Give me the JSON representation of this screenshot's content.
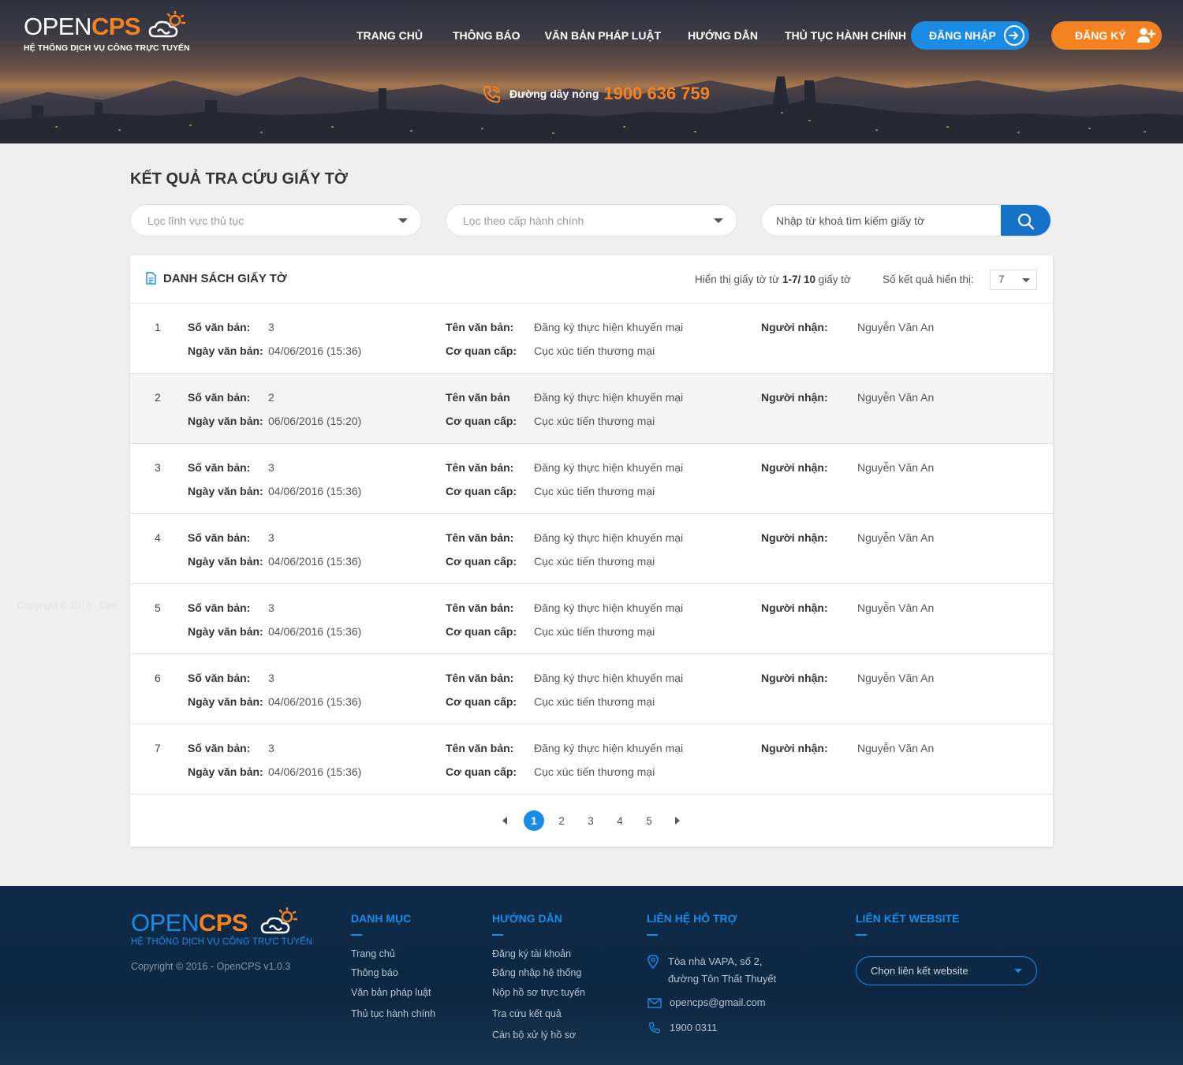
{
  "brand": {
    "name_part1": "OPEN",
    "name_part2": "CPS",
    "subtitle": "HỆ THỐNG DỊCH VỤ CÔNG TRỰC TUYẾN"
  },
  "nav": {
    "items": [
      {
        "label": "TRANG CHỦ"
      },
      {
        "label": "THÔNG BÁO"
      },
      {
        "label": "VĂN BẢN PHÁP LUẬT"
      },
      {
        "label": "HƯỚNG DẪN"
      },
      {
        "label": "THỦ TỤC HÀNH CHÍNH"
      }
    ],
    "login_label": "ĐĂNG NHẬP",
    "register_label": "ĐĂNG KÝ"
  },
  "hotline": {
    "label": "Đường dây nóng",
    "number": "1900 636 759"
  },
  "main": {
    "title": "KẾT QUẢ TRA CỨU GIẤY TỜ",
    "filter_field_placeholder": "Lọc lĩnh vực thủ tục",
    "filter_level_placeholder": "Lọc theo cấp hành chính",
    "search_placeholder": "Nhập từ khoá tìm kiếm giấy tờ"
  },
  "list": {
    "title": "DANH SÁCH GIẤY TỜ",
    "showing_prefix": "Hiển thị giấy tờ từ",
    "showing_range": "1-7/ 10",
    "showing_suffix": "giấy tờ",
    "per_page_label": "Số kết quả hiển thị:",
    "per_page_value": "7",
    "rows": [
      {
        "index": "1",
        "so_label": "Số văn bản:",
        "so": "3",
        "ngay_label": "Ngày văn bản:",
        "ngay": "04/06/2016 (15:36)",
        "ten_label": "Tên văn bản:",
        "ten": "Đăng ký thực hiện khuyến mại",
        "coquan_label": "Cơ quan cấp:",
        "coquan": "Cục xúc tiến thương mại",
        "nguoinhan_label": "Người nhận:",
        "nguoinhan": "Nguyễn Văn An"
      },
      {
        "index": "2",
        "so_label": "Số văn bản:",
        "so": "2",
        "ngay_label": "Ngày văn bản:",
        "ngay": "06/06/2016 (15:20)",
        "ten_label": "Tên văn bản",
        "ten": "Đăng ký thực hiện khuyến mại",
        "coquan_label": "Cơ quan cấp:",
        "coquan": "Cục xúc tiến thương mại",
        "nguoinhan_label": "Người nhận:",
        "nguoinhan": "Nguyễn Văn An"
      },
      {
        "index": "3",
        "so_label": "Số văn bản:",
        "so": "3",
        "ngay_label": "Ngày văn bản:",
        "ngay": "04/06/2016 (15:36)",
        "ten_label": "Tên văn bản:",
        "ten": "Đăng ký thực hiện khuyến mại",
        "coquan_label": "Cơ quan cấp:",
        "coquan": "Cục xúc tiến thương mại",
        "nguoinhan_label": "Người nhận:",
        "nguoinhan": "Nguyễn Văn An"
      },
      {
        "index": "4",
        "so_label": "Số văn bản:",
        "so": "3",
        "ngay_label": "Ngày văn bản:",
        "ngay": "04/06/2016 (15:36)",
        "ten_label": "Tên văn bản:",
        "ten": "Đăng ký thực hiện khuyến mại",
        "coquan_label": "Cơ quan cấp:",
        "coquan": "Cục xúc tiến thương mại",
        "nguoinhan_label": "Người nhận:",
        "nguoinhan": "Nguyễn Văn An"
      },
      {
        "index": "5",
        "so_label": "Số văn bản:",
        "so": "3",
        "ngay_label": "Ngày văn bản:",
        "ngay": "04/06/2016 (15:36)",
        "ten_label": "Tên văn bản:",
        "ten": "Đăng ký thực hiện khuyến mại",
        "coquan_label": "Cơ quan cấp:",
        "coquan": "Cục xúc tiến thương mại",
        "nguoinhan_label": "Người nhận:",
        "nguoinhan": "Nguyễn Văn An"
      },
      {
        "index": "6",
        "so_label": "Số văn bản:",
        "so": "3",
        "ngay_label": "Ngày văn bản:",
        "ngay": "04/06/2016 (15:36)",
        "ten_label": "Tên văn bản:",
        "ten": "Đăng ký thực hiện khuyến mại",
        "coquan_label": "Cơ quan cấp:",
        "coquan": "Cục xúc tiến thương mại",
        "nguoinhan_label": "Người nhận:",
        "nguoinhan": "Nguyễn Văn An"
      },
      {
        "index": "7",
        "so_label": "Số văn bản:",
        "so": "3",
        "ngay_label": "Ngày văn bản:",
        "ngay": "04/06/2016 (15:36)",
        "ten_label": "Tên văn bản:",
        "ten": "Đăng ký thực hiện khuyến mại",
        "coquan_label": "Cơ quan cấp:",
        "coquan": "Cục xúc tiến thương mại",
        "nguoinhan_label": "Người nhận:",
        "nguoinhan": "Nguyễn Văn An"
      }
    ],
    "pages": [
      "1",
      "2",
      "3",
      "4",
      "5"
    ],
    "current_page": "1"
  },
  "ghost_text": "Copyright © 2016 - Ope",
  "footer": {
    "copyright": "Copyright © 2016 - OpenCPS v1.0.3",
    "danh_muc": {
      "title": "DANH MỤC",
      "links": [
        "Trang chủ",
        "Thông báo",
        "Văn bản pháp luật",
        "Thủ tục hành chính"
      ]
    },
    "huong_dan": {
      "title": "HƯỚNG DẪN",
      "links": [
        "Đăng ký tài khoản",
        "Đăng nhập hệ thống",
        "Nộp hồ sơ trực tuyến",
        "Tra cứu kết quả",
        "Cán bộ xử lý hồ sơ"
      ]
    },
    "lien_he": {
      "title": "LIÊN HỆ HỖ TRỢ",
      "address_line1": "Tòa nhà VAPA, số 2,",
      "address_line2": "đường Tôn Thất Thuyết",
      "email": "opencps@gmail.com",
      "phone": "1900 0311"
    },
    "lien_ket": {
      "title": "LIÊN KẾT WEBSITE",
      "select_label": "Chọn liên kết website"
    }
  },
  "colors": {
    "accent_blue": "#1a8ce6",
    "accent_orange": "#f58220",
    "footer_bg": "#0e2a48"
  },
  "icons": [
    "cloud-logo-icon",
    "login-arrow-icon",
    "user-plus-icon",
    "phone-icon",
    "search-icon",
    "document-icon",
    "caret-down-icon",
    "chevron-left-icon",
    "chevron-right-icon",
    "map-pin-icon",
    "mail-icon"
  ]
}
